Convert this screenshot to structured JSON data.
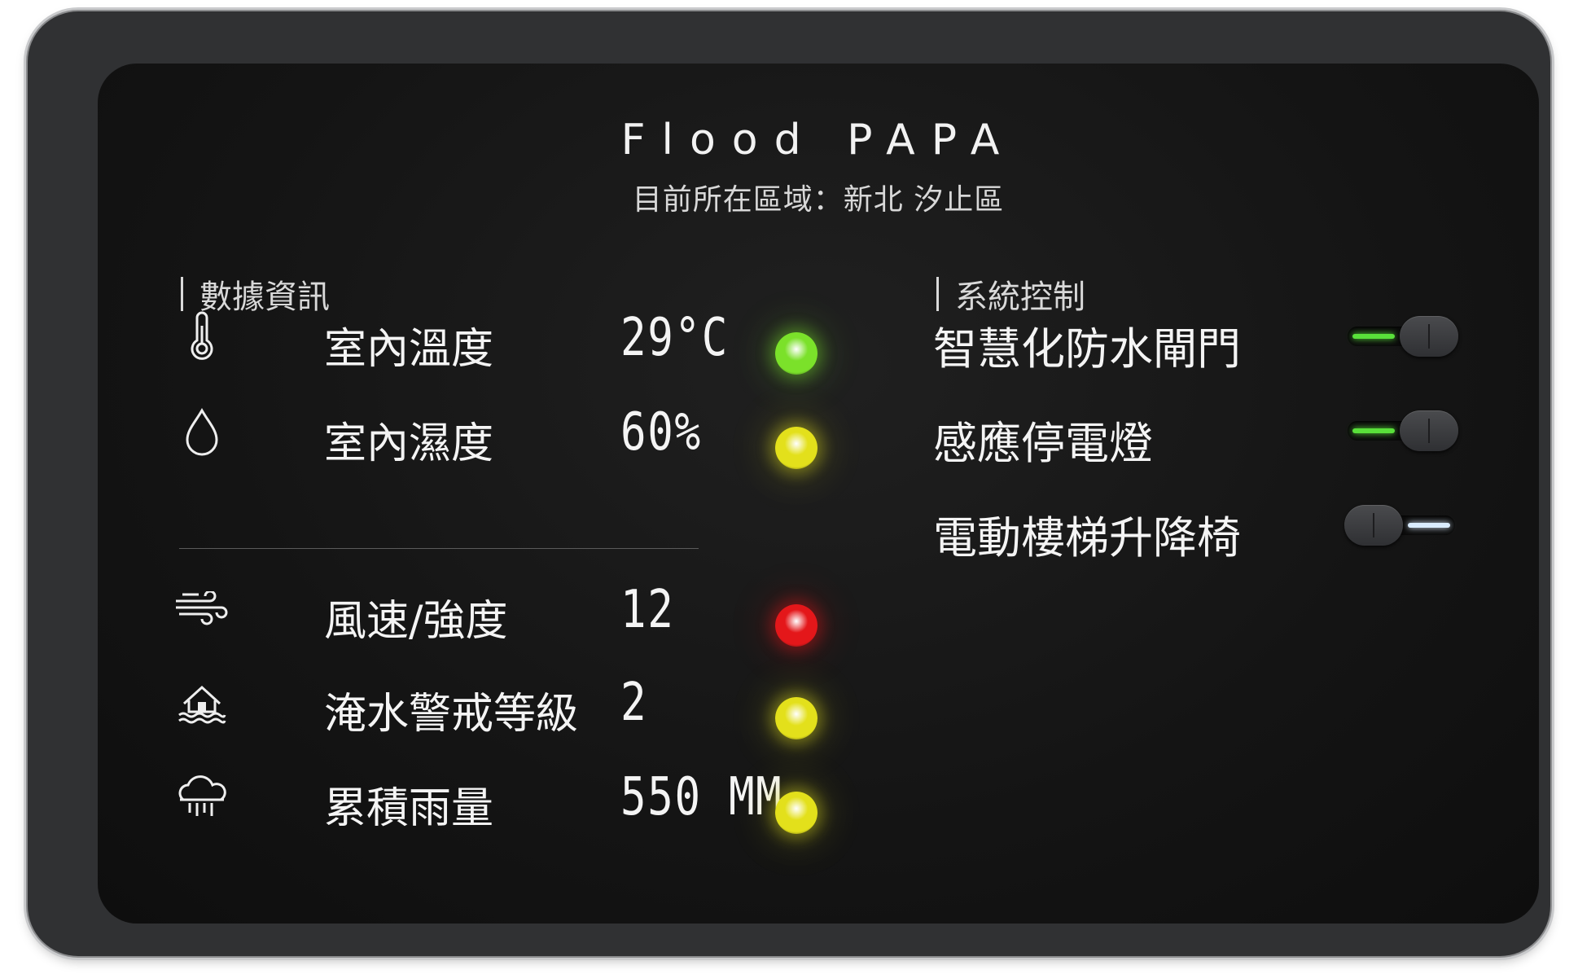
{
  "app": {
    "title": "Flood PAPA",
    "location_line": "目前所在區域：新北 汐止區"
  },
  "data_section": {
    "heading": "數據資訊",
    "rows": [
      {
        "icon": "thermometer-icon",
        "label": "室內溫度",
        "value": "29°C",
        "status_color": "#7be12a"
      },
      {
        "icon": "water-drop-icon",
        "label": "室內濕度",
        "value": "60%",
        "status_color": "#e3e01b"
      },
      {
        "icon": "wind-icon",
        "label": "風速/強度",
        "value": "12",
        "status_color": "#e4171a"
      },
      {
        "icon": "flooded-house-icon",
        "label": "淹水警戒等級",
        "value": "2",
        "status_color": "#e3e01b"
      },
      {
        "icon": "rain-cloud-icon",
        "label": "累積雨量",
        "value": "550 MM",
        "status_color": "#e3e01b"
      }
    ]
  },
  "control_section": {
    "heading": "系統控制",
    "controls": [
      {
        "label": "智慧化防水閘門",
        "on": true
      },
      {
        "label": "感應停電燈",
        "on": true
      },
      {
        "label": "電動樓梯升降椅",
        "on": false
      }
    ]
  },
  "colors": {
    "toggle_on_line": "#59e03a",
    "toggle_off_line": "#d9ecff",
    "screen_bg": "#141414",
    "bezel": "#303133"
  }
}
